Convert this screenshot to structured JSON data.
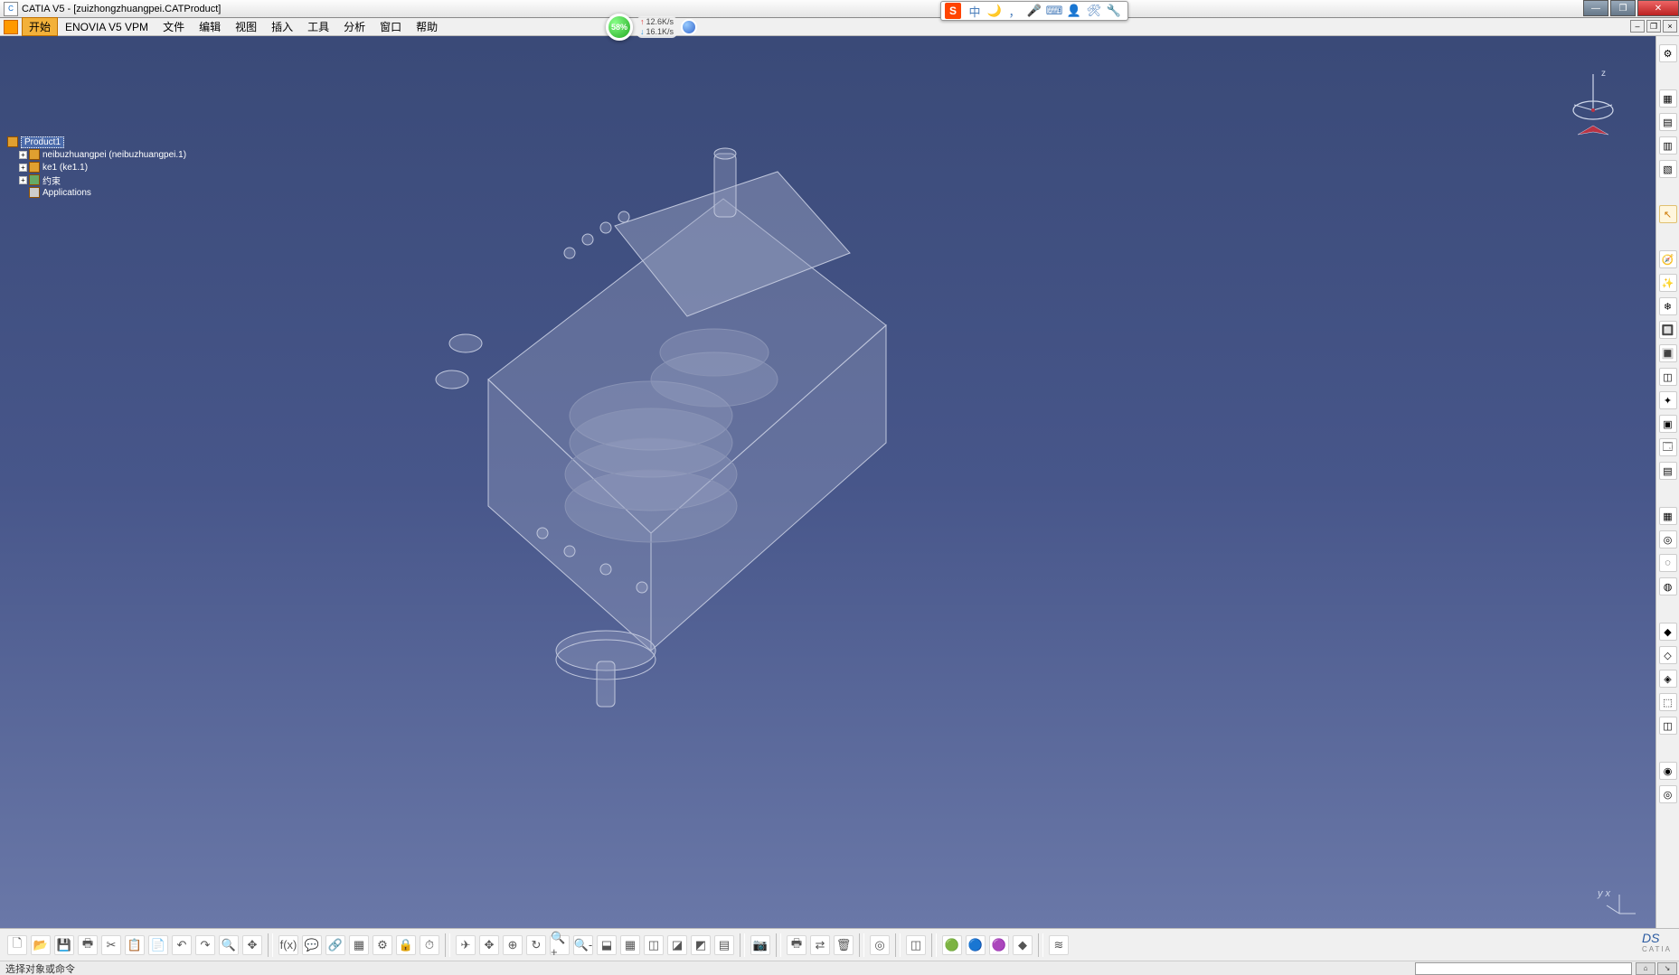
{
  "window": {
    "title": "CATIA V5 - [zuizhongzhuangpei.CATProduct]",
    "controls": {
      "min": "—",
      "max": "❐",
      "close": "✕"
    }
  },
  "ime": {
    "logo": "S",
    "icons": [
      "中",
      "🌙",
      "，",
      "🎤",
      "⌨",
      "👤",
      "🛠",
      "🔧"
    ]
  },
  "menu": {
    "start": "开始",
    "items": [
      "ENOVIA V5 VPM",
      "文件",
      "编辑",
      "视图",
      "插入",
      "工具",
      "分析",
      "窗口",
      "帮助"
    ],
    "mdi": {
      "min": "–",
      "restore": "❐",
      "close": "×"
    }
  },
  "net": {
    "percent": "58%",
    "up": "12.6K/s",
    "down": "16.1K/s"
  },
  "tree": {
    "root": "Product1",
    "children": [
      "neibuzhuangpei (neibuzhuangpei.1)",
      "ke1 (ke1.1)",
      "约束",
      "Applications"
    ]
  },
  "compass": {
    "z_label": "z"
  },
  "axis_triad": {
    "label": "y x"
  },
  "right_tools": {
    "group1": [
      "⚙",
      "▦",
      "▤",
      "▥",
      "▧"
    ],
    "arrow": "↖",
    "group2": [
      "🧭",
      "✨",
      "❄",
      "🔲",
      "🔳",
      "◫",
      "✦",
      "▣",
      "🗔",
      "▤"
    ],
    "group3": [
      "▦",
      "◎",
      "◌",
      "◍"
    ],
    "group4": [
      "◆",
      "◇",
      "◈",
      "⬚",
      "◫"
    ],
    "group5": [
      "◉",
      "◎"
    ]
  },
  "toolbar": {
    "file": [
      "🗋",
      "📂",
      "💾",
      "🖶",
      "✂",
      "📋",
      "📄",
      "↶",
      "↷",
      "🔍",
      "✥"
    ],
    "fx": [
      "f(x)",
      "💬",
      "🔗",
      "▦",
      "⚙",
      "🔒",
      "⏱"
    ],
    "view": [
      "✈",
      "✥",
      "⊕",
      "↻",
      "🔍+",
      "🔍-",
      "⬓",
      "▦",
      "◫",
      "◪",
      "◩",
      "▤"
    ],
    "cam": [
      "📷"
    ],
    "print": [
      "🖶",
      "⇄",
      "🗑"
    ],
    "misc1": [
      "◎"
    ],
    "misc2": [
      "◫"
    ],
    "color": [
      "🟢",
      "🔵",
      "🟣",
      "◆"
    ],
    "misc3": [
      "≋"
    ],
    "logo_main": "DS",
    "logo_sub": "CATIA"
  },
  "status": {
    "msg": "选择对象或命令",
    "input_value": "",
    "btn1": "⌂",
    "btn2": "↘"
  }
}
